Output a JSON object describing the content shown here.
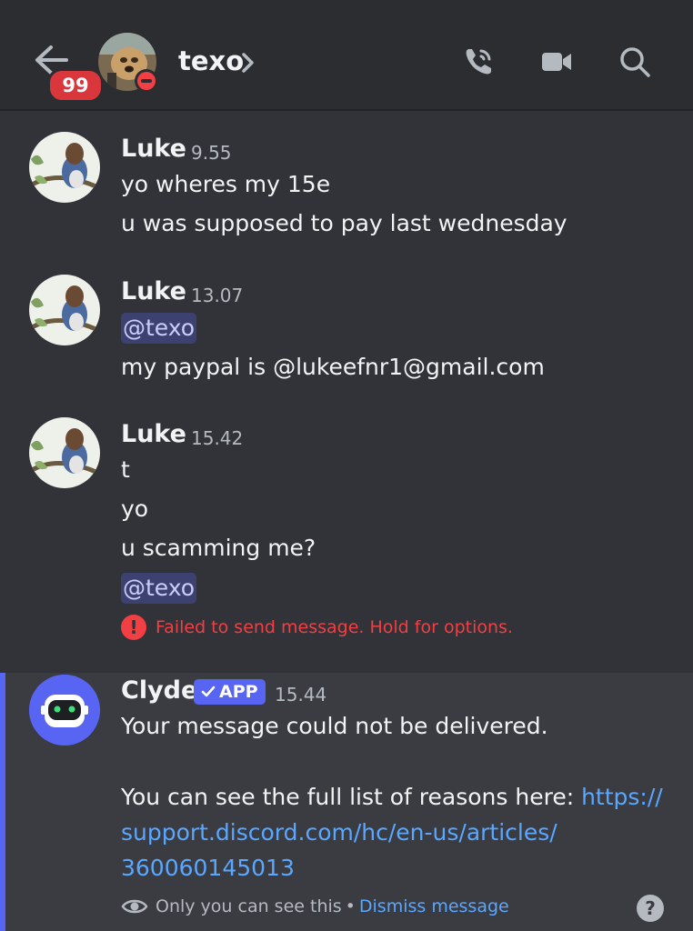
{
  "header": {
    "unread_count": "99",
    "channel_name": "texo",
    "icons": [
      "back-arrow-icon",
      "chevron-right-icon",
      "voice-call-icon",
      "video-call-icon",
      "search-icon"
    ],
    "status": "do-not-disturb"
  },
  "messages": [
    {
      "author": "Luke",
      "time": "9.55",
      "lines": [
        "yo wheres my 15e",
        "u was supposed to pay last wednesday"
      ]
    },
    {
      "author": "Luke",
      "time": "13.07",
      "mention": "@texo",
      "lines": [
        "my paypal is @lukeefnr1@gmail.com"
      ]
    },
    {
      "author": "Luke",
      "time": "15.42",
      "lines": [
        "t",
        "yo",
        "u scamming me?"
      ],
      "mention": "@texo",
      "error": "Failed to send message. Hold for options."
    }
  ],
  "clyde": {
    "author": "Clyde",
    "tag": "APP",
    "time": "15.44",
    "line1": "Your message could not be delivered.",
    "line2_prefix": "You can see the full list of reasons here: ",
    "link_part1": "https://",
    "link_part2": "support.discord.com/hc/en-us/articles/",
    "link_part3": "360060145013",
    "ephemeral_note": "Only you can see this",
    "separator": "•",
    "dismiss": "Dismiss message",
    "help": "?"
  },
  "colors": {
    "background": "#313338",
    "header": "#2b2d31",
    "accent": "#5865f2",
    "error": "#f23f43",
    "link": "#5aa7ff"
  }
}
